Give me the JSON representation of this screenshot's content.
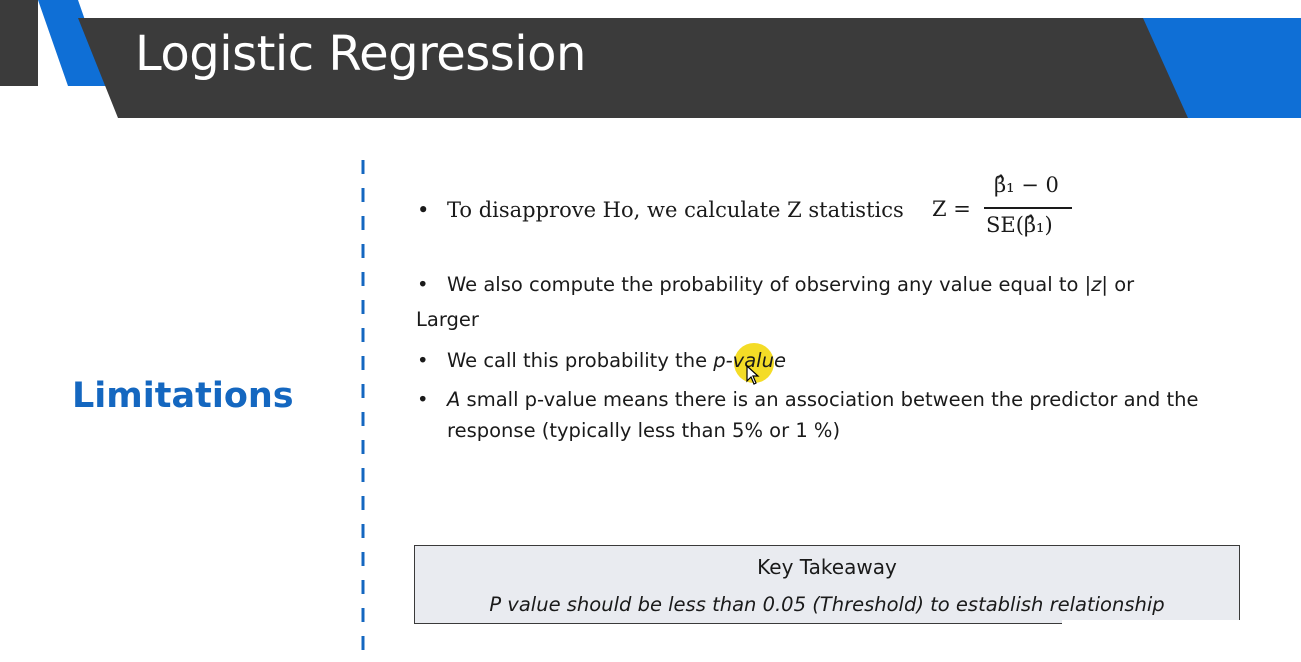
{
  "slide": {
    "title": "Logistic Regression",
    "section_label": "Limitations"
  },
  "bullets": {
    "b1_text": "To disapprove  Ho, we calculate Z statistics",
    "formula": {
      "lhs": "Z =",
      "numerator": "β̂₁ − 0",
      "denominator": "SE(β̂₁)"
    },
    "b2_before": "We also compute the probability of observing any value equal to ",
    "b2_italic": "|z|",
    "b2_after": " or",
    "b2_continuation": "Larger",
    "b3_before": "We call this probability the ",
    "b3_italic": "p-value",
    "b4_italic": "A",
    "b4_after": " small p-value means there is an association between the predictor and the response (typically less than 5% or 1 %)"
  },
  "takeaway": {
    "title": "Key Takeaway",
    "body": "P value should be less than 0.05 (Threshold) to establish relationship"
  },
  "colors": {
    "header_bg": "#3b3b3b",
    "accent_blue": "#1467c0",
    "takeaway_bg": "#e9ebf0",
    "highlight": "#f2d600"
  },
  "icons": {
    "cursor": "mouse-pointer-icon"
  }
}
